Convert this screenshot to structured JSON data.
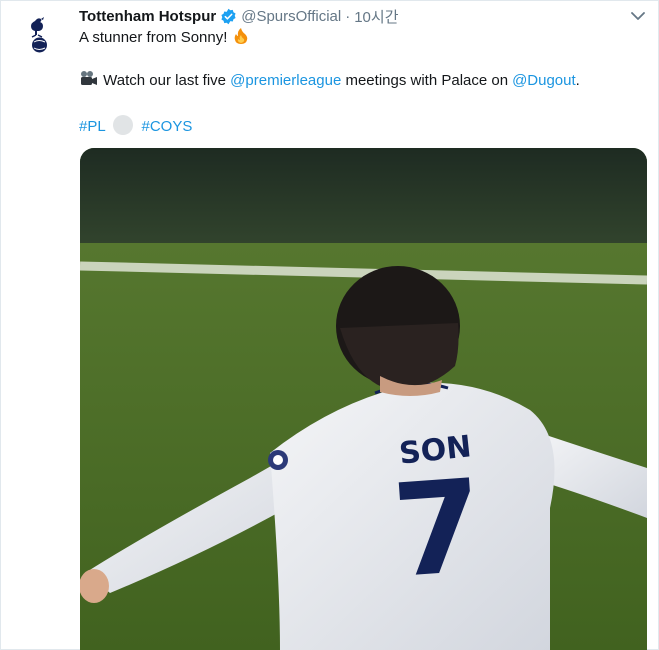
{
  "tweet": {
    "author_name": "Tottenham Hotspur",
    "handle": "@SpursOfficial",
    "separator": "·",
    "time": "10시간",
    "line1_text": "A stunner from Sonny!",
    "line2_prefix": "Watch our last five",
    "mention1": "@premierleague",
    "line2_middle": "meetings with Palace on",
    "mention2": "@Dugout",
    "line2_suffix": ".",
    "hashtag1": "#PL",
    "hashtag2": "#COYS"
  },
  "media": {
    "jersey_name": "SON",
    "jersey_number": "7"
  },
  "icons": {
    "avatar": "spurs-crest-icon",
    "verified": "verified-badge-icon",
    "menu": "chevron-down-icon",
    "fire": "fire-emoji-icon",
    "camera": "movie-camera-emoji-icon"
  },
  "colors": {
    "link": "#1b95e0",
    "verified": "#1da1f2",
    "secondary_text": "#657786",
    "primary_text": "#14171a"
  }
}
